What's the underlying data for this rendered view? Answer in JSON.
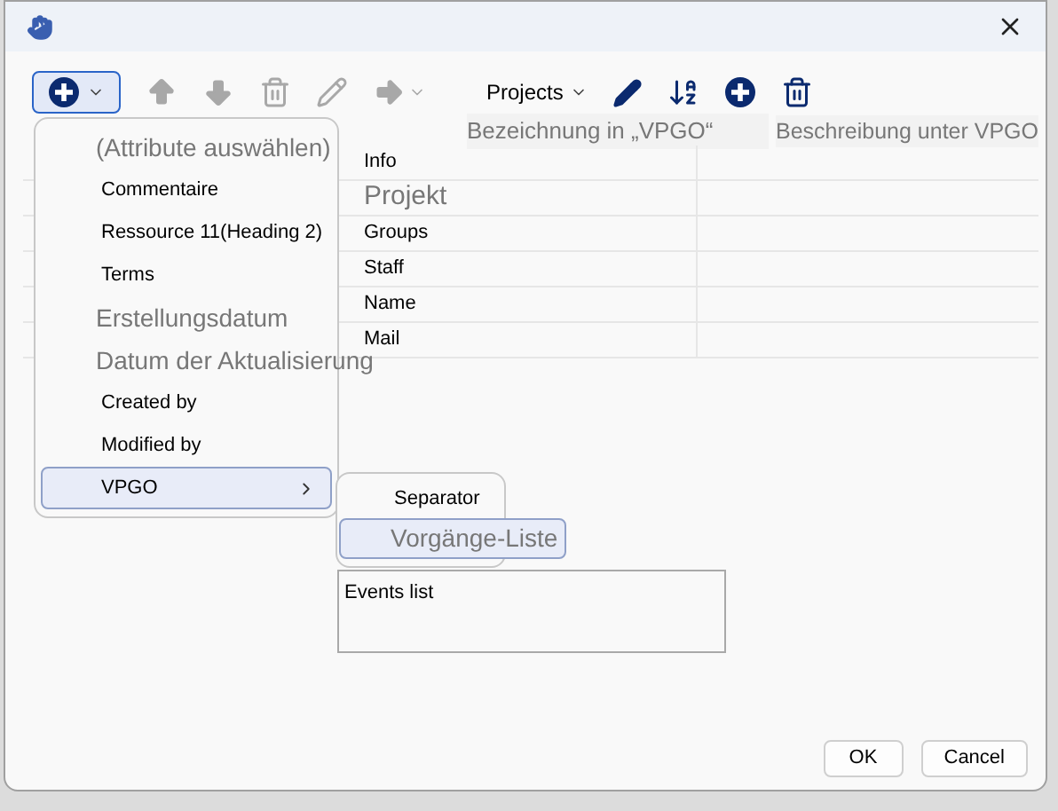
{
  "toolbar": {
    "add_button": {
      "selected": true
    },
    "tools": [
      {
        "kind": "up",
        "disabled": true
      },
      {
        "kind": "down",
        "disabled": true
      },
      {
        "kind": "delete",
        "disabled": true
      },
      {
        "kind": "edit",
        "disabled": true
      },
      {
        "kind": "move",
        "disabled": true
      }
    ],
    "dropdown": {
      "label": "Projects"
    },
    "actions": [
      {
        "kind": "edit"
      },
      {
        "kind": "sort"
      },
      {
        "kind": "add"
      },
      {
        "kind": "delete"
      }
    ]
  },
  "table": {
    "columns": [
      "Bezeichnung in „VPGO“",
      "Beschreibung unter VPGO"
    ],
    "rows": [
      {
        "name": "Info",
        "kind": "item"
      },
      {
        "name": "Projekt",
        "kind": "heading"
      },
      {
        "name": "Groups",
        "kind": "item"
      },
      {
        "name": "Staff",
        "kind": "item"
      },
      {
        "name": "Name",
        "kind": "item"
      },
      {
        "name": "Mail",
        "kind": "item"
      }
    ]
  },
  "menu": {
    "items": [
      {
        "label": "(Attribute auswählen)",
        "kind": "placeholder",
        "selected": false
      },
      {
        "label": "Commentaire",
        "kind": "item",
        "selected": false
      },
      {
        "label": "Ressource 11(Heading 2)",
        "kind": "item",
        "selected": false
      },
      {
        "label": "Terms",
        "kind": "item",
        "selected": false
      },
      {
        "label": "Erstellungsdatum",
        "kind": "placeholder",
        "selected": false
      },
      {
        "label": "Datum der Aktualisierung",
        "kind": "placeholder",
        "selected": false
      },
      {
        "label": "Created by",
        "kind": "item",
        "selected": false
      },
      {
        "label": "Modified by",
        "kind": "item",
        "selected": false
      },
      {
        "label": "VPGO",
        "kind": "submenu",
        "selected": true
      }
    ]
  },
  "submenu": {
    "items": [
      {
        "label": "Separator",
        "kind": "item",
        "selected": false
      },
      {
        "label": "Vorgänge-Liste",
        "kind": "placeholder",
        "selected": true
      }
    ]
  },
  "events_box": {
    "value": "Events list"
  },
  "buttons": [
    "OK",
    "Cancel"
  ]
}
